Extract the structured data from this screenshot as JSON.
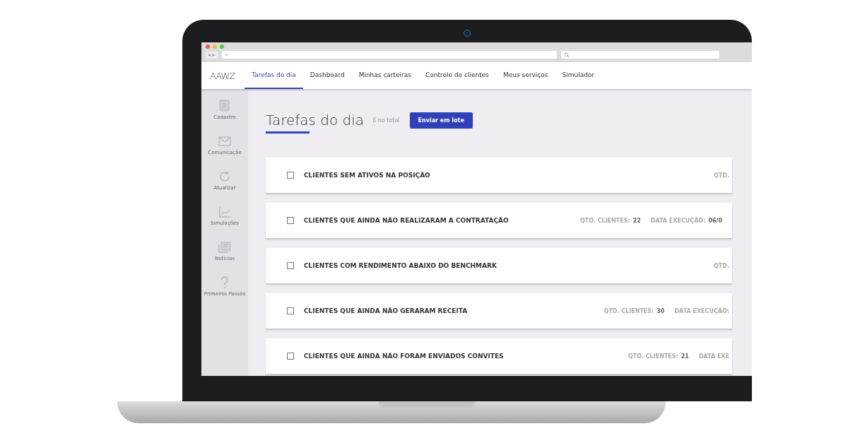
{
  "browser": {
    "nav_buttons": "◂ ▸",
    "address": "+"
  },
  "nav": {
    "logo": "AAWZ",
    "tabs": [
      {
        "label": "Tarefas do dia",
        "selected": true
      },
      {
        "label": "Dashboard",
        "selected": false
      },
      {
        "label": "Minhas carteiras",
        "selected": false
      },
      {
        "label": "Controle de clientes",
        "selected": false
      },
      {
        "label": "Meus serviços",
        "selected": false
      },
      {
        "label": "Simulador",
        "selected": false
      }
    ]
  },
  "sidebar": {
    "items": [
      {
        "kind": "form",
        "label": "Cadastro"
      },
      {
        "kind": "mail",
        "label": "Comunicação"
      },
      {
        "kind": "refresh",
        "label": "Atualizar"
      },
      {
        "kind": "chart",
        "label": "Simulações"
      },
      {
        "kind": "news",
        "label": "Notícias"
      },
      {
        "kind": "help",
        "label": "Primeiros Passos"
      }
    ]
  },
  "header": {
    "title": "Tarefas do dia",
    "count": "6 no total",
    "button": "Enviar em lote"
  },
  "tasks": [
    {
      "title": "CLIENTES SEM ATIVOS NA POSIÇÃO",
      "checked": false,
      "meta": [
        {
          "label": "QTD."
        }
      ]
    },
    {
      "title": "CLIENTES QUE AINDA NÃO REALIZARAM A CONTRATAÇÃO",
      "checked": false,
      "meta": [
        {
          "label": "QTD. CLIENTES:",
          "value": "22"
        },
        {
          "label": "DATA EXECUÇÃO:",
          "value": "06/0"
        }
      ]
    },
    {
      "title": "CLIENTES COM RENDIMENTO ABAIXO DO BENCHMARK",
      "checked": false,
      "meta": [
        {
          "label": "QTD."
        }
      ]
    },
    {
      "title": "CLIENTES QUE AINDA NÃO GERARAM RECEITA",
      "checked": false,
      "meta": [
        {
          "label": "QTD. CLIENTES:",
          "value": "30"
        },
        {
          "label": "DATA EXECUÇÃO:"
        }
      ]
    },
    {
      "title": "CLIENTES QUE AINDA NÃO FORAM ENVIADOS CONVITES",
      "checked": false,
      "meta": [
        {
          "label": "QTD. CLIENTES:",
          "value": "21"
        },
        {
          "label": "DATA EXE"
        }
      ]
    }
  ]
}
